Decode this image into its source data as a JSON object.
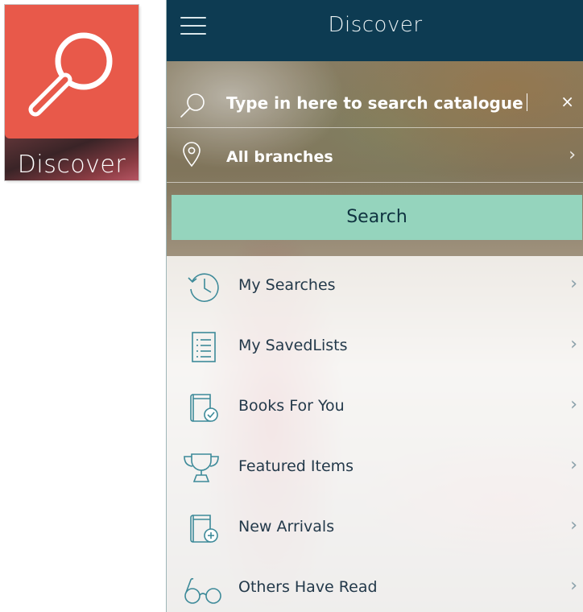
{
  "tile": {
    "label": "Discover",
    "icon": "magnifier-icon",
    "color": "#e8594a"
  },
  "header": {
    "title": "Discover",
    "menu_icon": "hamburger-icon",
    "color": "#0d3b52"
  },
  "search": {
    "placeholder": "Type  in here  to search catalogue",
    "clear_glyph": "×",
    "icon": "search-icon"
  },
  "branch": {
    "label": "All branches",
    "icon": "location-pin-icon",
    "chevron": "›"
  },
  "search_button": {
    "label": "Search",
    "color": "#95d4bd"
  },
  "menu": {
    "chevron": "›",
    "items": [
      {
        "label": "My Searches",
        "icon": "history-clock-icon"
      },
      {
        "label": "My SavedLists",
        "icon": "list-document-icon"
      },
      {
        "label": "Books For You",
        "icon": "book-check-icon"
      },
      {
        "label": "Featured Items",
        "icon": "trophy-icon"
      },
      {
        "label": "New Arrivals",
        "icon": "book-plus-icon"
      },
      {
        "label": "Others Have Read",
        "icon": "glasses-icon"
      }
    ],
    "icon_color": "#3d8a99"
  }
}
